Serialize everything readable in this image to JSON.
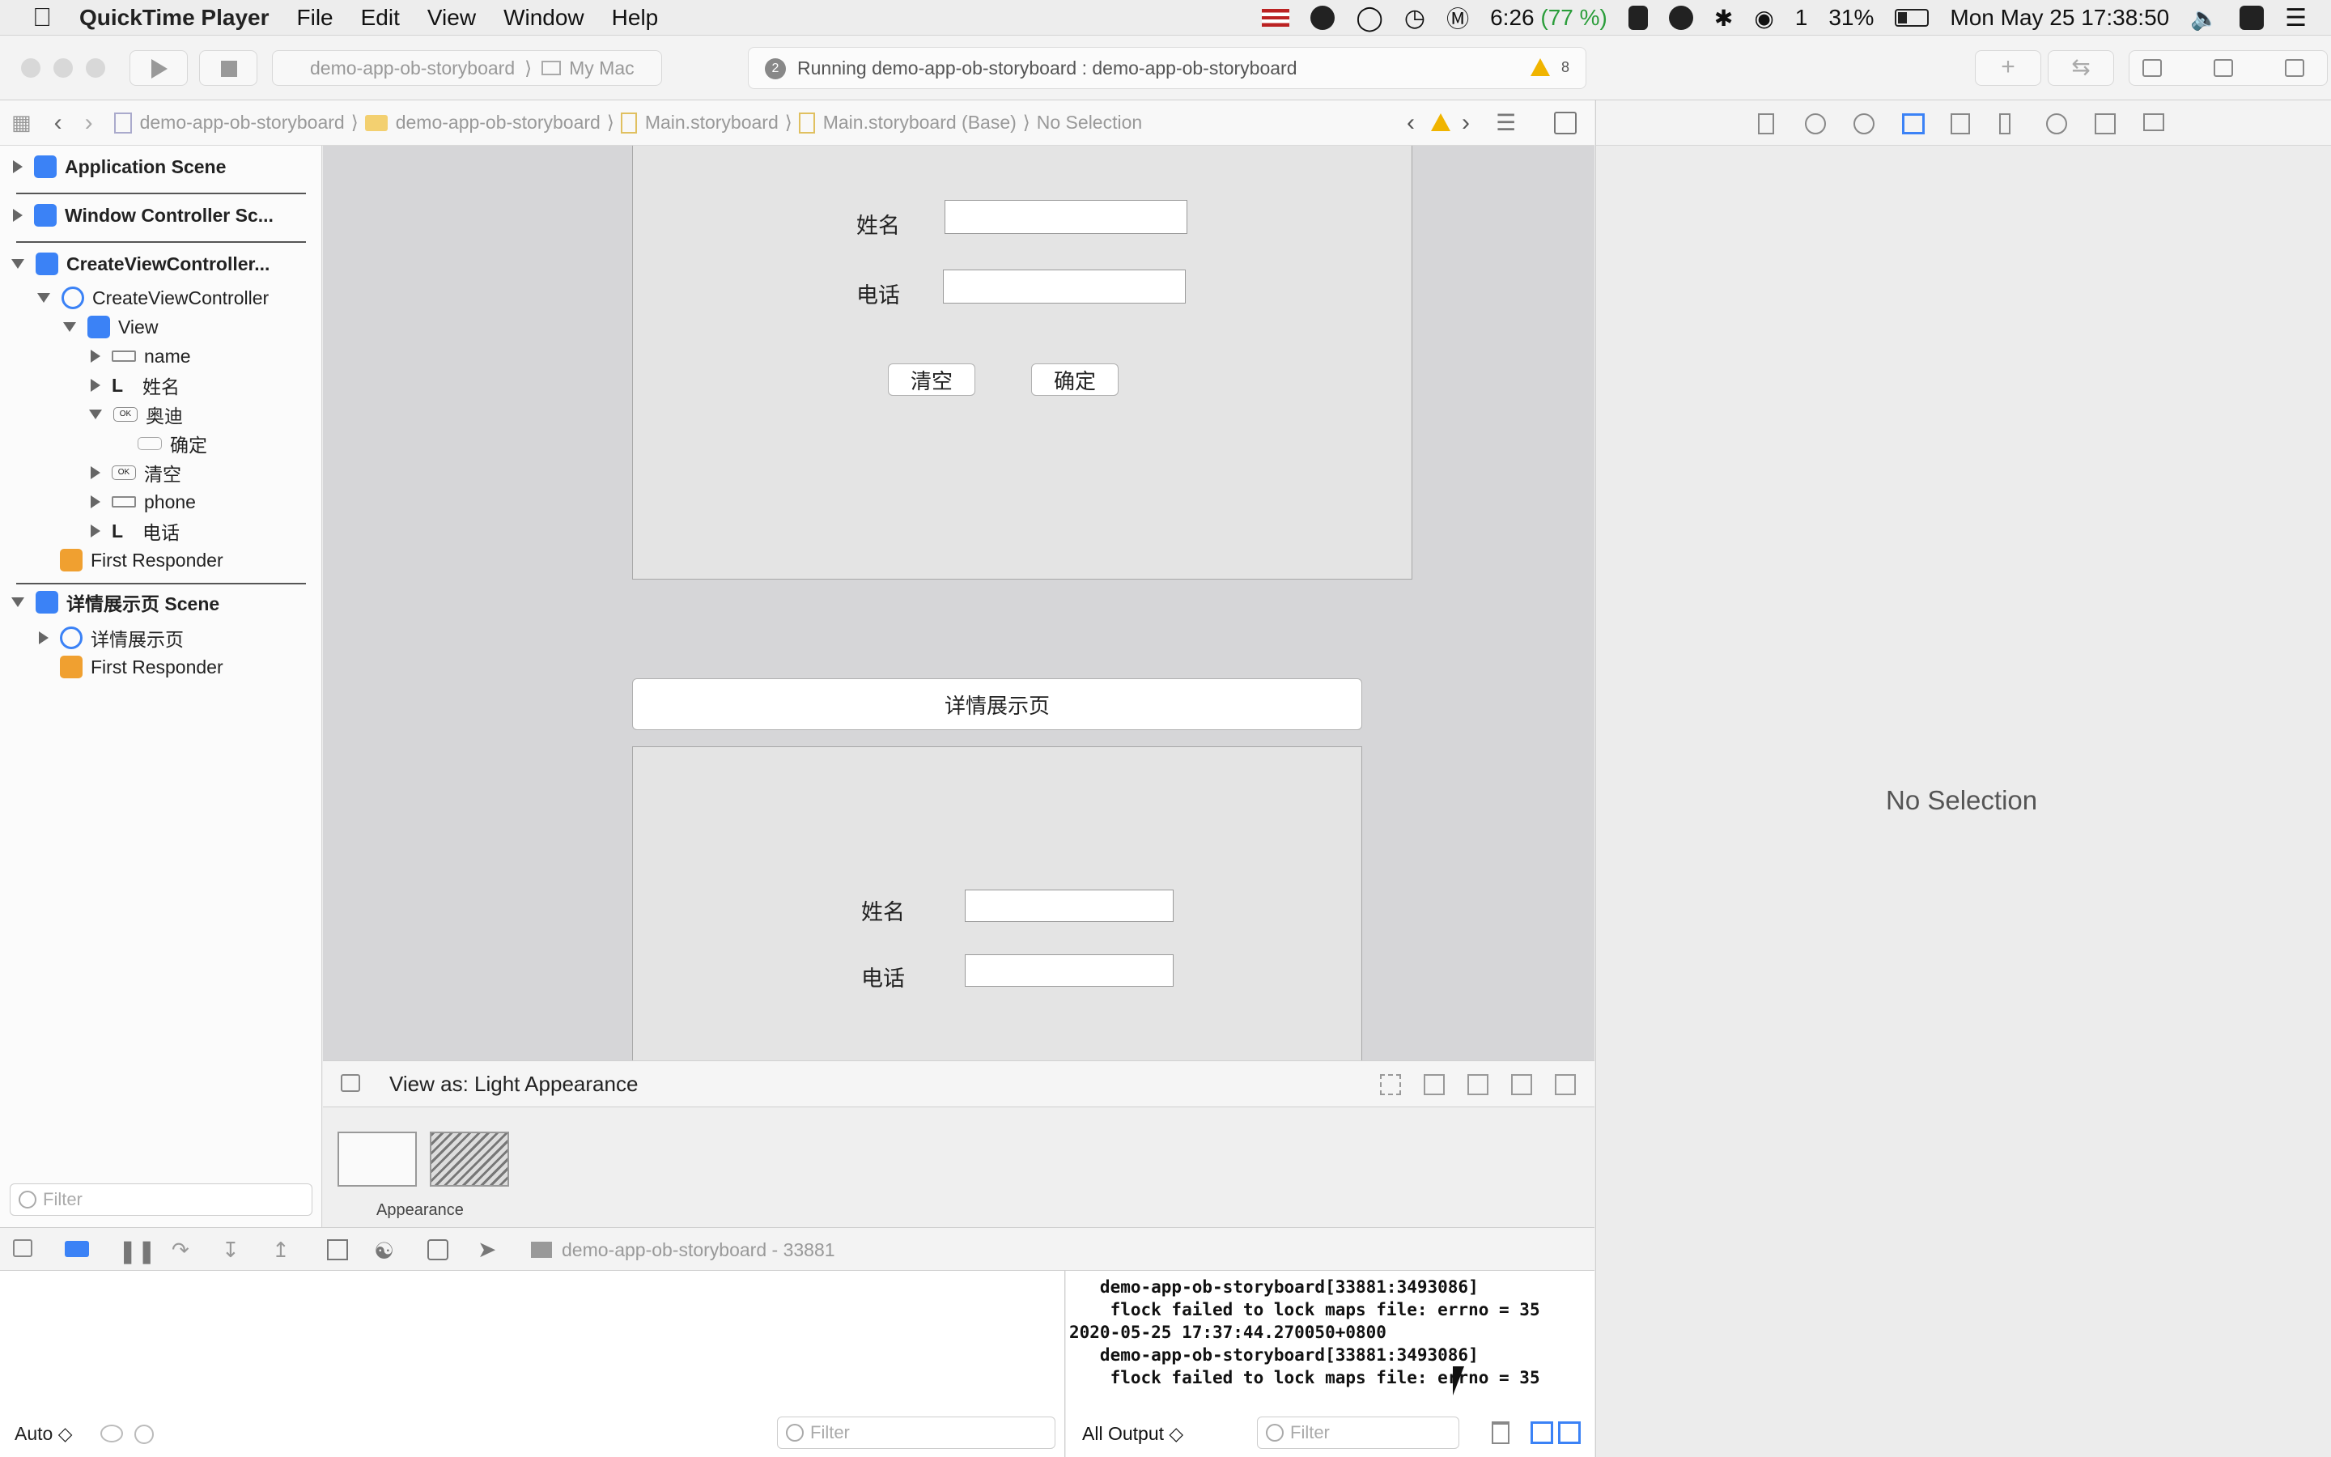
{
  "menubar": {
    "app_name": "QuickTime Player",
    "menus": [
      "File",
      "Edit",
      "View",
      "Window",
      "Help"
    ],
    "status": {
      "time": "6:26",
      "battery_pct": "(77 %)",
      "wechat_count": "1",
      "battery": "31%",
      "clock": "Mon May 25  17:38:50"
    }
  },
  "toolbar": {
    "scheme": "demo-app-ob-storyboard",
    "destination": "My Mac",
    "activity_badge": "2",
    "activity": "Running demo-app-ob-storyboard : demo-app-ob-storyboard",
    "warning_count": "8"
  },
  "jumpbar": {
    "crumbs": [
      "demo-app-ob-storyboard",
      "demo-app-ob-storyboard",
      "Main.storyboard",
      "Main.storyboard (Base)",
      "No Selection"
    ]
  },
  "navigator": {
    "items": [
      {
        "label": "Application Scene"
      },
      {
        "label": "Window Controller Sc..."
      },
      {
        "label": "CreateViewController..."
      },
      {
        "label": "CreateViewController"
      },
      {
        "label": "View"
      },
      {
        "label": "name"
      },
      {
        "label": "姓名"
      },
      {
        "label": "奥迪"
      },
      {
        "label": "确定"
      },
      {
        "label": "清空"
      },
      {
        "label": "phone"
      },
      {
        "label": "电话"
      },
      {
        "label": "First Responder"
      },
      {
        "label": "详情展示页 Scene"
      },
      {
        "label": "详情展示页"
      },
      {
        "label": "First Responder"
      }
    ],
    "filter_placeholder": "Filter"
  },
  "canvas": {
    "form1": {
      "name_label": "姓名",
      "phone_label": "电话",
      "clear_button": "清空",
      "ok_button": "确定"
    },
    "detail_title": "详情展示页",
    "form2": {
      "name_label": "姓名",
      "phone_label": "电话"
    }
  },
  "viewas": {
    "label": "View as: Light Appearance",
    "appearance_caption": "Appearance"
  },
  "inspector": {
    "empty": "No Selection"
  },
  "debug": {
    "process": "demo-app-ob-storyboard - 33881",
    "auto": "Auto ◇",
    "all_output": "All Output ◇",
    "filter_placeholder": "Filter",
    "console_lines": [
      "   demo-app-ob-storyboard[33881:3493086]",
      "    flock failed to lock maps file: errno = 35",
      "2020-05-25 17:37:44.270050+0800",
      "   demo-app-ob-storyboard[33881:3493086]",
      "    flock failed to lock maps file: errno = 35"
    ]
  }
}
